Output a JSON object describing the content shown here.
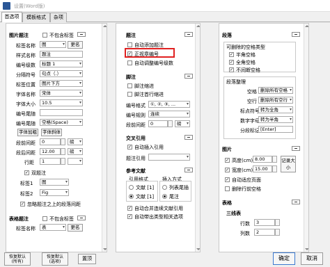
{
  "window": {
    "title": "设置(Word版)"
  },
  "tabs": [
    "首选项",
    "模板格式",
    "杂项"
  ],
  "left": {
    "fig_title": "图片题注",
    "fig_no_table": "不包含标签",
    "label_name_l": "标签名称",
    "label_name_v": "图",
    "more": "更名",
    "style_name_l": "样式名称",
    "style_name_v": "题注",
    "num_level_l": "编号级数",
    "num_level_v": "标题 1",
    "sep_l": "分隔符号",
    "sep_v": "句点（.）",
    "pos_l": "标签位置",
    "pos_v": "图片下方",
    "font_name_l": "字体名称",
    "font_name_v": "宋体",
    "font_size_l": "字体大小",
    "font_size_v": "10.5",
    "num_tail_l": "编号尾随",
    "num_tail_v": "",
    "num_tail2_l": "编号尾随",
    "num_tail2_v": "空格(Space)",
    "font_bold": "字体加粗",
    "font_italic": "字体斜体",
    "before_l": "段前间距",
    "before_v": "0",
    "before_u": "磅",
    "after_l": "段后间距",
    "after_v": "12.00",
    "after_u": "磅",
    "line_l": "行距",
    "line_v": "1",
    "dual": "双题注",
    "label1_l": "标签1",
    "label1_v": "图",
    "label2_l": "标签2",
    "label2_v": "Fig",
    "ignore": "忽略题注之上的段落间距",
    "table_title": "表格题注",
    "tbl_no_table": "不包含标签",
    "tbl_label_l": "标签名称",
    "tbl_label_v": "表",
    "tbl_more": "更名"
  },
  "mid": {
    "footnote_title": "题注",
    "fn1": "自动添加题注",
    "fn2": "正视章编号",
    "fn3": "自动调整编号级数",
    "endnote_title": "脚注",
    "en1": "脚注缩进",
    "en2": "脚注首行缩进",
    "num_fmt_l": "编号格式",
    "num_fmt_v": "①, ②, ③, ...",
    "num_rule_l": "编号规则",
    "num_rule_v": "连续",
    "para_gap_l": "段前间距",
    "para_gap_v": "0",
    "para_gap_u": "磅",
    "xref_title": "交叉引用",
    "xref1": "自动插入引用",
    "xref_fmt_l": "题注引用",
    "ref_title": "参考文献",
    "ref_fmt_l": "引用格式",
    "ref_ins_l": "插入方式",
    "ref_r1": "文献 [1]",
    "ref_r2": "文献 [1]",
    "ref_r3": "列表尾插",
    "ref_r4": "尾注",
    "ref_c1": "自动合并连续文献引用",
    "ref_c2": "自动带出类型相关选项"
  },
  "right": {
    "para_title": "段落",
    "para_sub": "可删除的空格类型",
    "p1": "半角空格",
    "p2": "全角空格",
    "p3": "不间断空格",
    "clean_title": "段落整理",
    "space_l": "空格",
    "space_v": "删除所有空格",
    "blank_l": "空行",
    "blank_v": "删除所有空行",
    "punct_l": "标点符号",
    "punct_v": "转为全角",
    "digit_l": "数字字母",
    "digit_v": "转为半角",
    "brk_l": "分段标记",
    "brk_v": "[Enter]",
    "pic_title": "图片",
    "h_l": "高度(cm)",
    "h_v": "8.00",
    "w_l": "宽度(cm)",
    "w_v": "15.00",
    "remember": "记录大小",
    "auto_fit": "自动适应页面",
    "del_sp": "删除行前空格",
    "table_title": "表格",
    "three_line": "三线表",
    "rows_l": "行数",
    "rows_v": "3",
    "cols_l": "列数",
    "cols_v": "2"
  },
  "footer": {
    "restore_all": "恢复默认\n(所有)",
    "restore_cur": "恢复默认\n(选项)",
    "import": "置顶",
    "ok": "确定",
    "cancel": "取消"
  }
}
